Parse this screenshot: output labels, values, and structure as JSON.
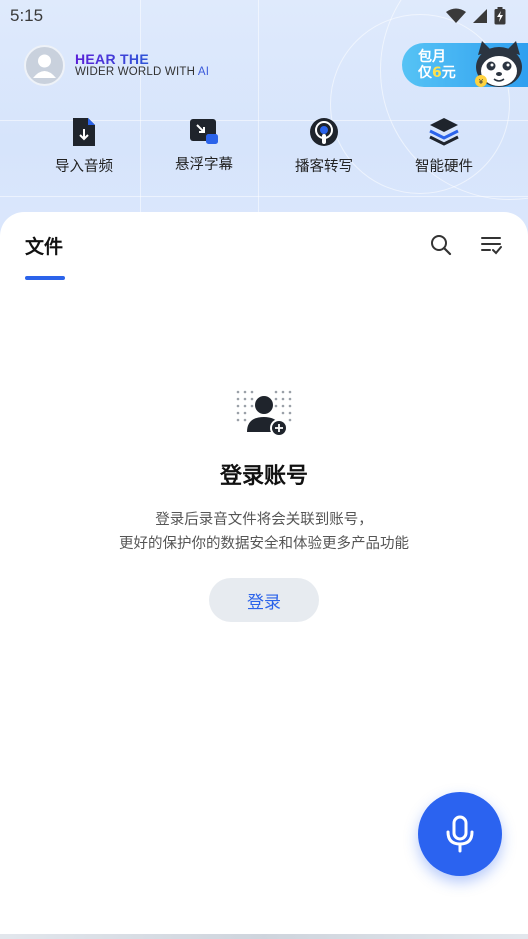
{
  "status_bar": {
    "time": "5:15",
    "icons": [
      "wifi-icon",
      "cellular-signal-icon",
      "battery-charging-icon"
    ]
  },
  "header": {
    "brand_line1": "HEAR THE",
    "brand_line2_prefix": "WIDER WORLD WITH ",
    "brand_line2_ai": "AI",
    "promo": {
      "line1": "包月",
      "line2_prefix": "仅",
      "line2_price": "6",
      "line2_suffix": "元"
    }
  },
  "quick_actions": [
    {
      "label": "导入音频",
      "icon": "import-audio-icon"
    },
    {
      "label": "悬浮字幕",
      "icon": "floating-subtitle-icon"
    },
    {
      "label": "播客转写",
      "icon": "podcast-transcribe-icon"
    },
    {
      "label": "智能硬件",
      "icon": "smart-hardware-icon"
    }
  ],
  "tabs": {
    "files_label": "文件",
    "actions": [
      "search-icon",
      "sort-filter-icon"
    ]
  },
  "empty_state": {
    "icon": "user-add-icon",
    "title": "登录账号",
    "desc_line1": "登录后录音文件将会关联到账号，",
    "desc_line2": "更好的保护你的数据安全和体验更多产品功能",
    "login_button": "登录"
  },
  "fab": {
    "icon": "microphone-icon"
  },
  "colors": {
    "accent": "#2b63ea",
    "header_bg": "#dbe7fc",
    "promo_bg": "#2f9ff0",
    "promo_price": "#ffe14d"
  }
}
